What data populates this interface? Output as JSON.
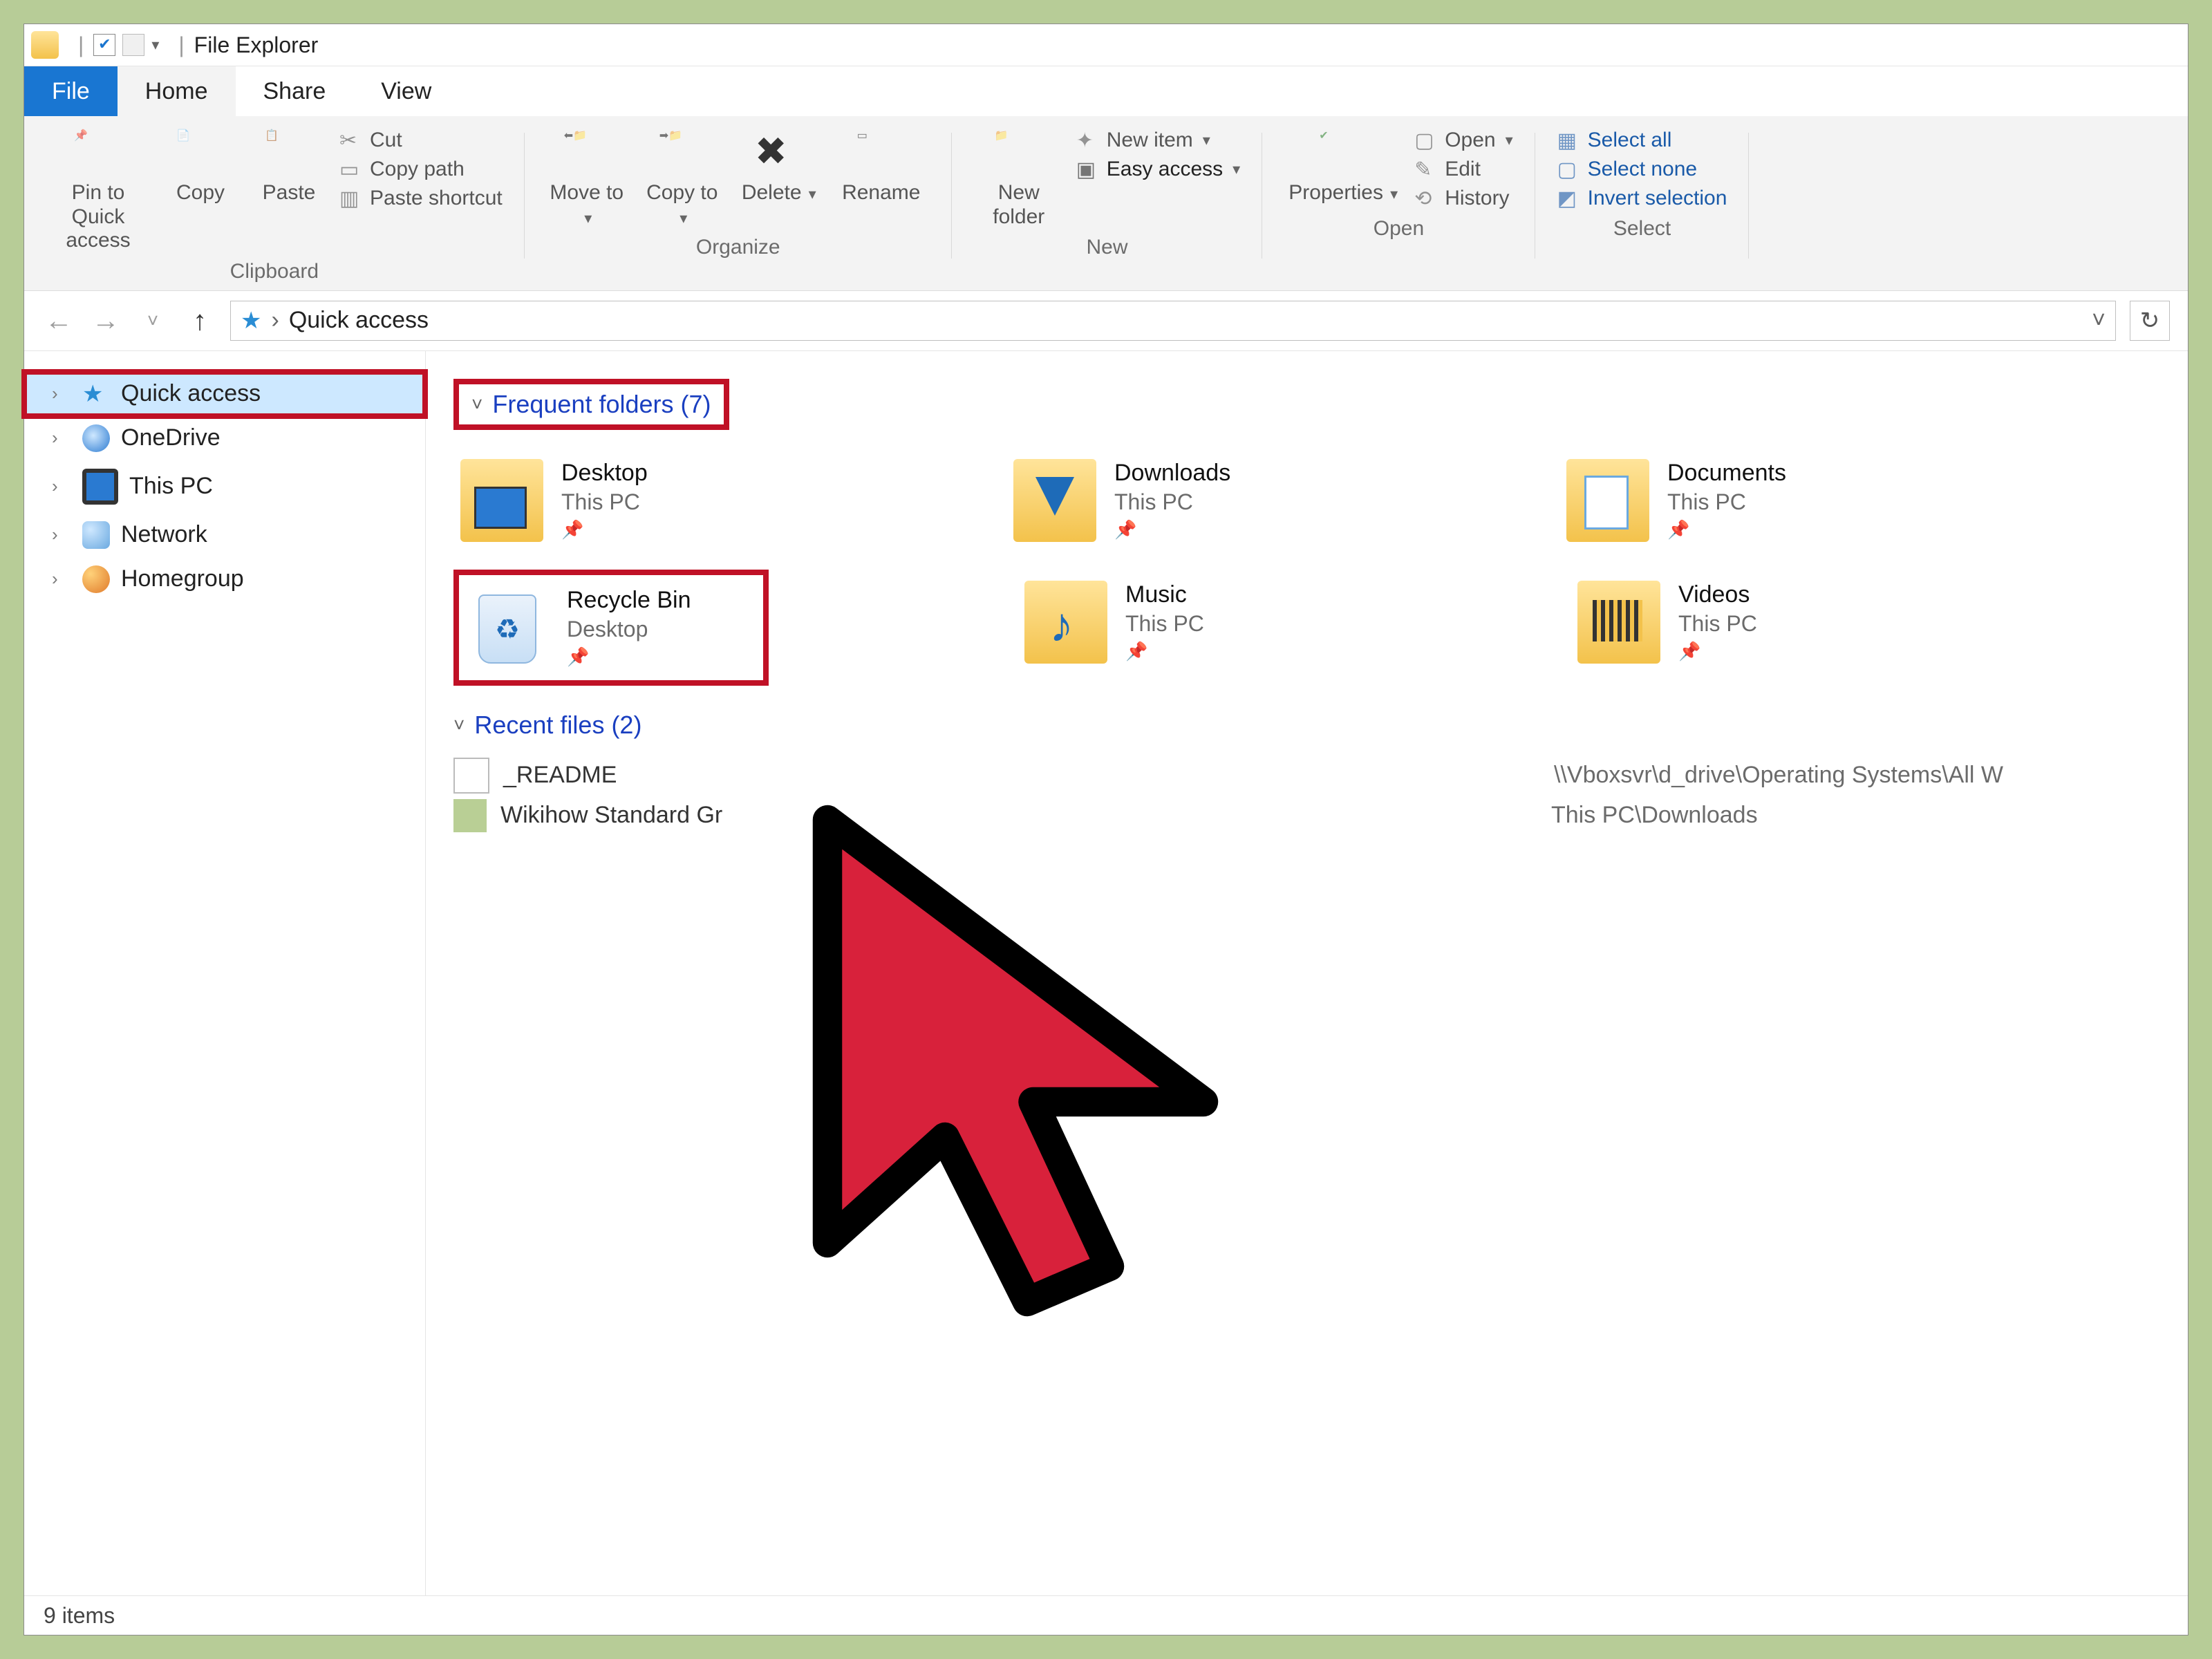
{
  "title": "File Explorer",
  "tabs": {
    "file": "File",
    "home": "Home",
    "share": "Share",
    "view": "View"
  },
  "ribbon": {
    "clipboard": {
      "label": "Clipboard",
      "pin": "Pin to Quick access",
      "copy": "Copy",
      "paste": "Paste",
      "cut": "Cut",
      "copypath": "Copy path",
      "pastesc": "Paste shortcut"
    },
    "organize": {
      "label": "Organize",
      "moveto": "Move to",
      "copyto": "Copy to",
      "delete": "Delete",
      "rename": "Rename"
    },
    "new": {
      "label": "New",
      "newfolder": "New folder",
      "newitem": "New item",
      "easyaccess": "Easy access"
    },
    "open": {
      "label": "Open",
      "properties": "Properties",
      "open": "Open",
      "edit": "Edit",
      "history": "History"
    },
    "select": {
      "label": "Select",
      "all": "Select all",
      "none": "Select none",
      "invert": "Invert selection"
    }
  },
  "address": {
    "location": "Quick access"
  },
  "sidebar": {
    "items": [
      {
        "label": "Quick access"
      },
      {
        "label": "OneDrive"
      },
      {
        "label": "This PC"
      },
      {
        "label": "Network"
      },
      {
        "label": "Homegroup"
      }
    ]
  },
  "sections": {
    "freq": {
      "label": "Frequent folders (7)"
    },
    "recent": {
      "label": "Recent files (2)"
    }
  },
  "folders": [
    {
      "name": "Desktop",
      "sub": "This PC"
    },
    {
      "name": "Downloads",
      "sub": "This PC"
    },
    {
      "name": "Documents",
      "sub": "This PC"
    },
    {
      "name": "Recycle Bin",
      "sub": "Desktop"
    },
    {
      "name": "Music",
      "sub": "This PC"
    },
    {
      "name": "Videos",
      "sub": "This PC"
    }
  ],
  "files": [
    {
      "name": "_README",
      "path": "\\\\Vboxsvr\\d_drive\\Operating Systems\\All W"
    },
    {
      "name": "Wikihow Standard Gr",
      "path": "This PC\\Downloads"
    }
  ],
  "status": "9 items"
}
